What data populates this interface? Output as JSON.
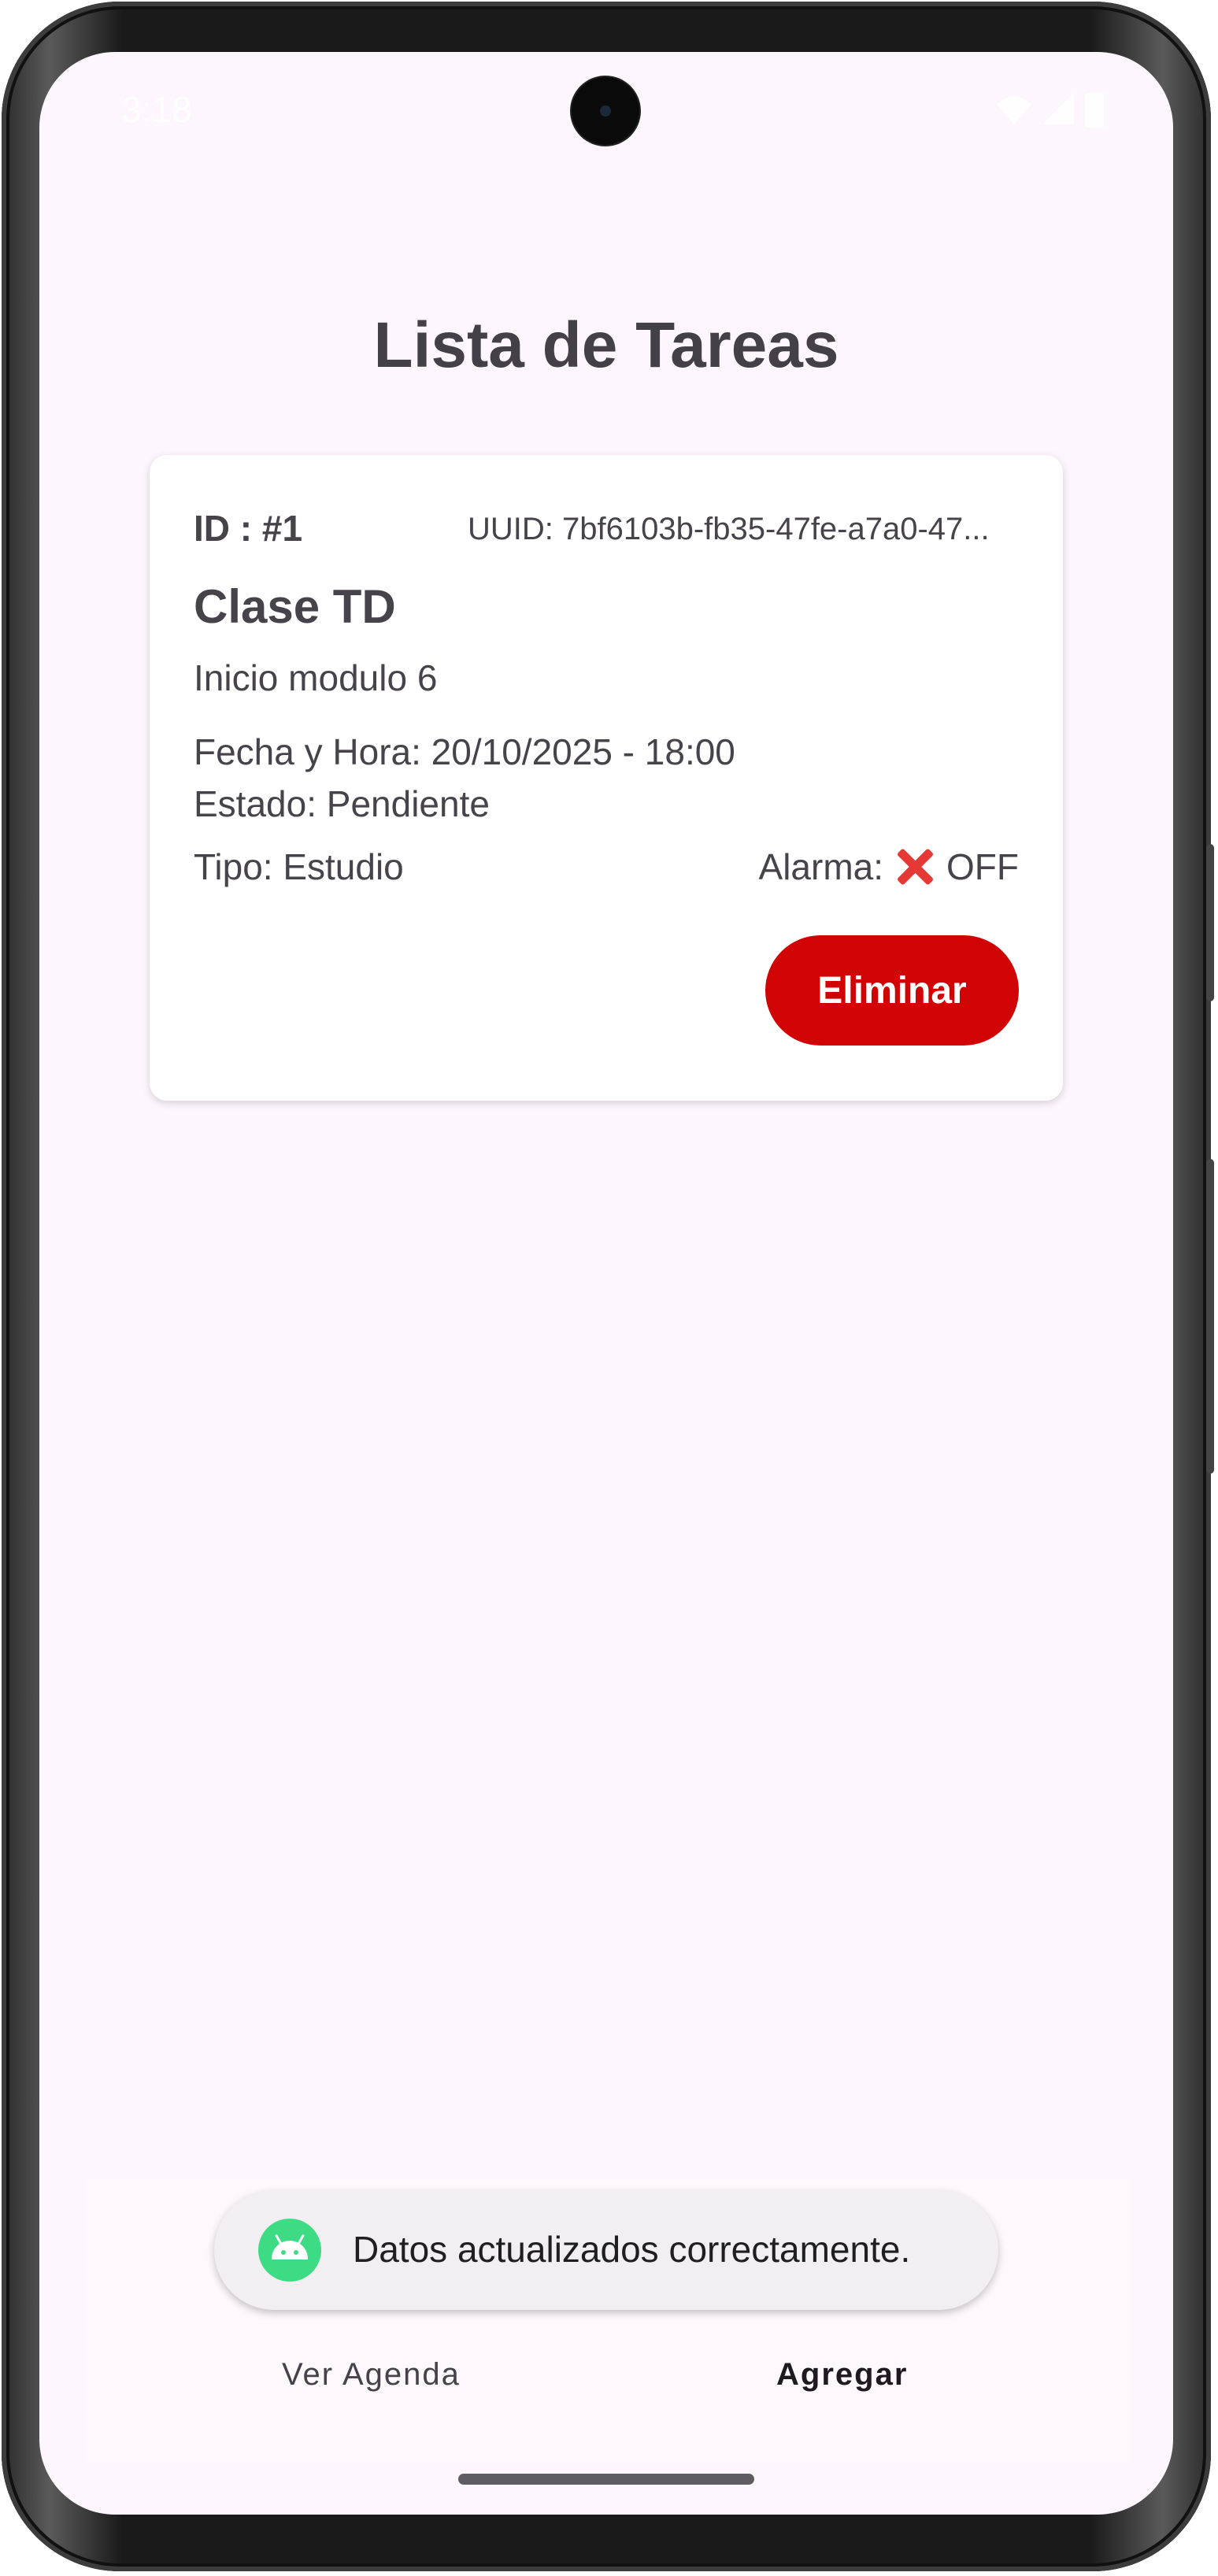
{
  "status_bar": {
    "time": "3:18",
    "icons": [
      "shield-icon",
      "sd-card-icon",
      "wifi-icon",
      "signal-icon",
      "battery-icon"
    ]
  },
  "screen": {
    "title": "Lista de Tareas"
  },
  "task_card": {
    "id": "ID  : #1",
    "uuid": "UUID: 7bf6103b-fb35-47fe-a7a0-47...",
    "title": "Clase TD",
    "description": "Inicio modulo 6",
    "datetime": "Fecha y Hora: 20/10/2025 - 18:00",
    "status": "Estado: Pendiente",
    "type": "Tipo: Estudio",
    "alarm_label": "Alarma:",
    "alarm_value": "OFF",
    "delete_label": "Eliminar"
  },
  "bottom_nav": {
    "items": [
      {
        "label": "Ver Agenda"
      },
      {
        "label": "Agregar"
      }
    ]
  },
  "toast": {
    "message": "Datos actualizados correctamente."
  },
  "colors": {
    "background": "#fdf6fd",
    "delete_button": "#d00404",
    "alarm_off_icon": "#e53935",
    "toast_icon": "#3ddc84"
  }
}
